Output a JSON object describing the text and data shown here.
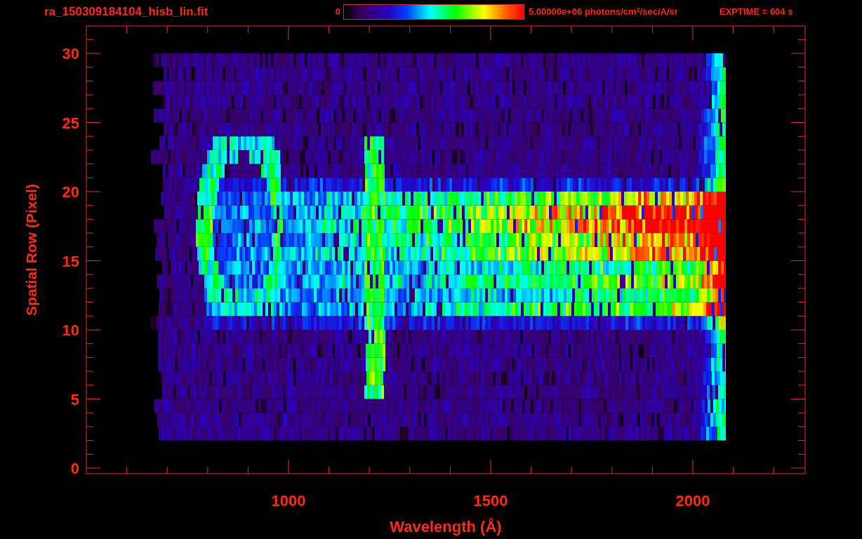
{
  "title": "ra_150309184104_hisb_lin.fit",
  "colorbar": {
    "min_label": "0",
    "max_label": "5.00000e+06 photons/cm$^{2}$/sec/A/sr"
  },
  "exposure": "EXPTIME = 604 s",
  "plot": {
    "xlabel": "Wavelength (Å)",
    "ylabel": "Spatial Row (Pixel)",
    "xticks": [
      "1000",
      "1500",
      "2000"
    ],
    "yticks": [
      "30",
      "25",
      "20",
      "15",
      "10",
      "5",
      "0"
    ]
  }
}
